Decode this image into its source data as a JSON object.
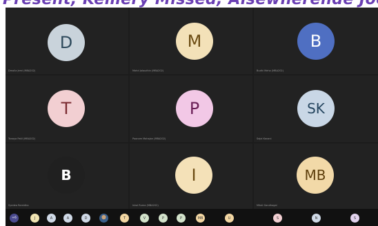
{
  "page": {
    "top_banner_text": "Present, Kemery Missed, Alsewherende Jocod,",
    "colors": {
      "stage_bg": "#1c1c1c",
      "tile_bg": "#222222",
      "bar_bg": "#111111",
      "banner": "#6a3fb3"
    }
  },
  "tiles": [
    {
      "initials": "D",
      "name": "Dmolia Jemi (MBA202)",
      "avatar_bg": "#c9d3db",
      "text_color": "#2e4a5c"
    },
    {
      "initials": "M",
      "name": "Mohd Jalaudhin (MBA202)",
      "avatar_bg": "#f3e1b8",
      "text_color": "#6b4b12"
    },
    {
      "initials": "B",
      "name": "Budhi Meha (MBA202)",
      "avatar_bg": "#4f6fc2",
      "text_color": "#ffffff"
    },
    {
      "initials": "T",
      "name": "Tanaya Patil (MBA202)",
      "avatar_bg": "#f2cfd2",
      "text_color": "#7a2b31"
    },
    {
      "initials": "P",
      "name": "Poonam Mahajan (MBA202)",
      "avatar_bg": "#f2c8e6",
      "text_color": "#6b1f57"
    },
    {
      "initials": "SK",
      "name": "Sejal Kanani",
      "avatar_bg": "#c9d7e6",
      "text_color": "#264660"
    },
    {
      "initials": "B",
      "name": "Syedea Ramidha",
      "avatar_bg": "#202020",
      "text_color": "#ffffff"
    },
    {
      "initials": "I",
      "name": "Ishal Ruma (MBA202)",
      "avatar_bg": "#f4e1b8",
      "text_color": "#6b4b12"
    },
    {
      "initials": "MB",
      "name": "Mitali Gandhogal",
      "avatar_bg": "#f2d9a8",
      "text_color": "#5e3f0c"
    }
  ],
  "participant_bar": [
    {
      "label": "+6",
      "bg": "#4b4b8f",
      "kind": "count"
    },
    {
      "label": "J",
      "bg": "#f1e5b3"
    },
    {
      "label": "A",
      "bg": "#cfd9e6"
    },
    {
      "label": "A",
      "bg": "#cfd9e6"
    },
    {
      "label": "D",
      "bg": "#cfd9e6"
    },
    {
      "label": "",
      "bg": "#3b5f8a",
      "kind": "photo-avatar-icon"
    },
    {
      "label": "T",
      "bg": "#f3d7a3"
    },
    {
      "label": "V",
      "bg": "#d3e3cb"
    },
    {
      "label": "P",
      "bg": "#d3e3cb"
    },
    {
      "label": "P",
      "bg": "#d3e3cb"
    },
    {
      "label": "MB",
      "bg": "#f3d7a3"
    },
    {
      "label": "U",
      "bg": "#f3d7a3"
    },
    {
      "label": "S",
      "bg": "#f2cfd2"
    },
    {
      "label": "N",
      "bg": "#cfd9e6"
    },
    {
      "label": "S",
      "bg": "#e2d3ee"
    }
  ]
}
